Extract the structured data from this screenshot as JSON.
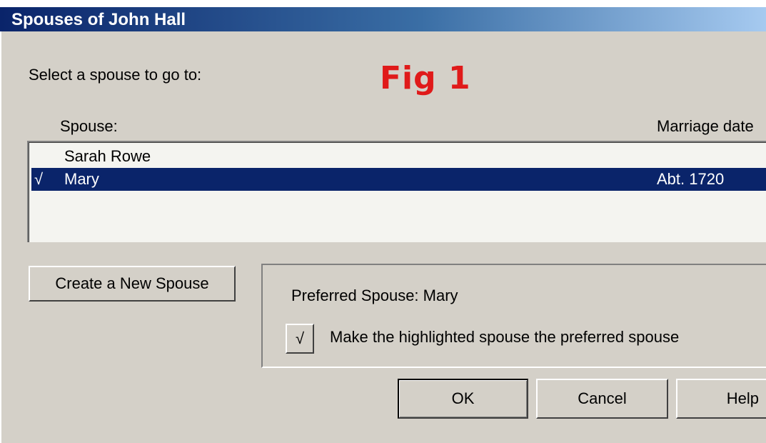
{
  "window": {
    "title": "Spouses of John Hall"
  },
  "annotation": {
    "text": "Fig 1",
    "color": "#e01a1a"
  },
  "prompt": "Select a spouse to go to:",
  "list": {
    "columns": {
      "spouse": "Spouse:",
      "marriage_date": "Marriage date"
    },
    "rows": [
      {
        "mark": "",
        "name": "Sarah Rowe",
        "date": "",
        "selected": false
      },
      {
        "mark": "√",
        "name": "Mary",
        "date": "Abt. 1720",
        "selected": true
      }
    ]
  },
  "buttons": {
    "create_new": "Create a New Spouse",
    "ok": "OK",
    "cancel": "Cancel",
    "help": "Help"
  },
  "preferred": {
    "label": "Preferred Spouse: Mary",
    "toggle_mark": "√",
    "toggle_label": "Make the highlighted spouse the preferred spouse"
  },
  "colors": {
    "titlebar_start": "#0a246a",
    "selection": "#0a246a",
    "dialog_bg": "#d4d0c8"
  }
}
